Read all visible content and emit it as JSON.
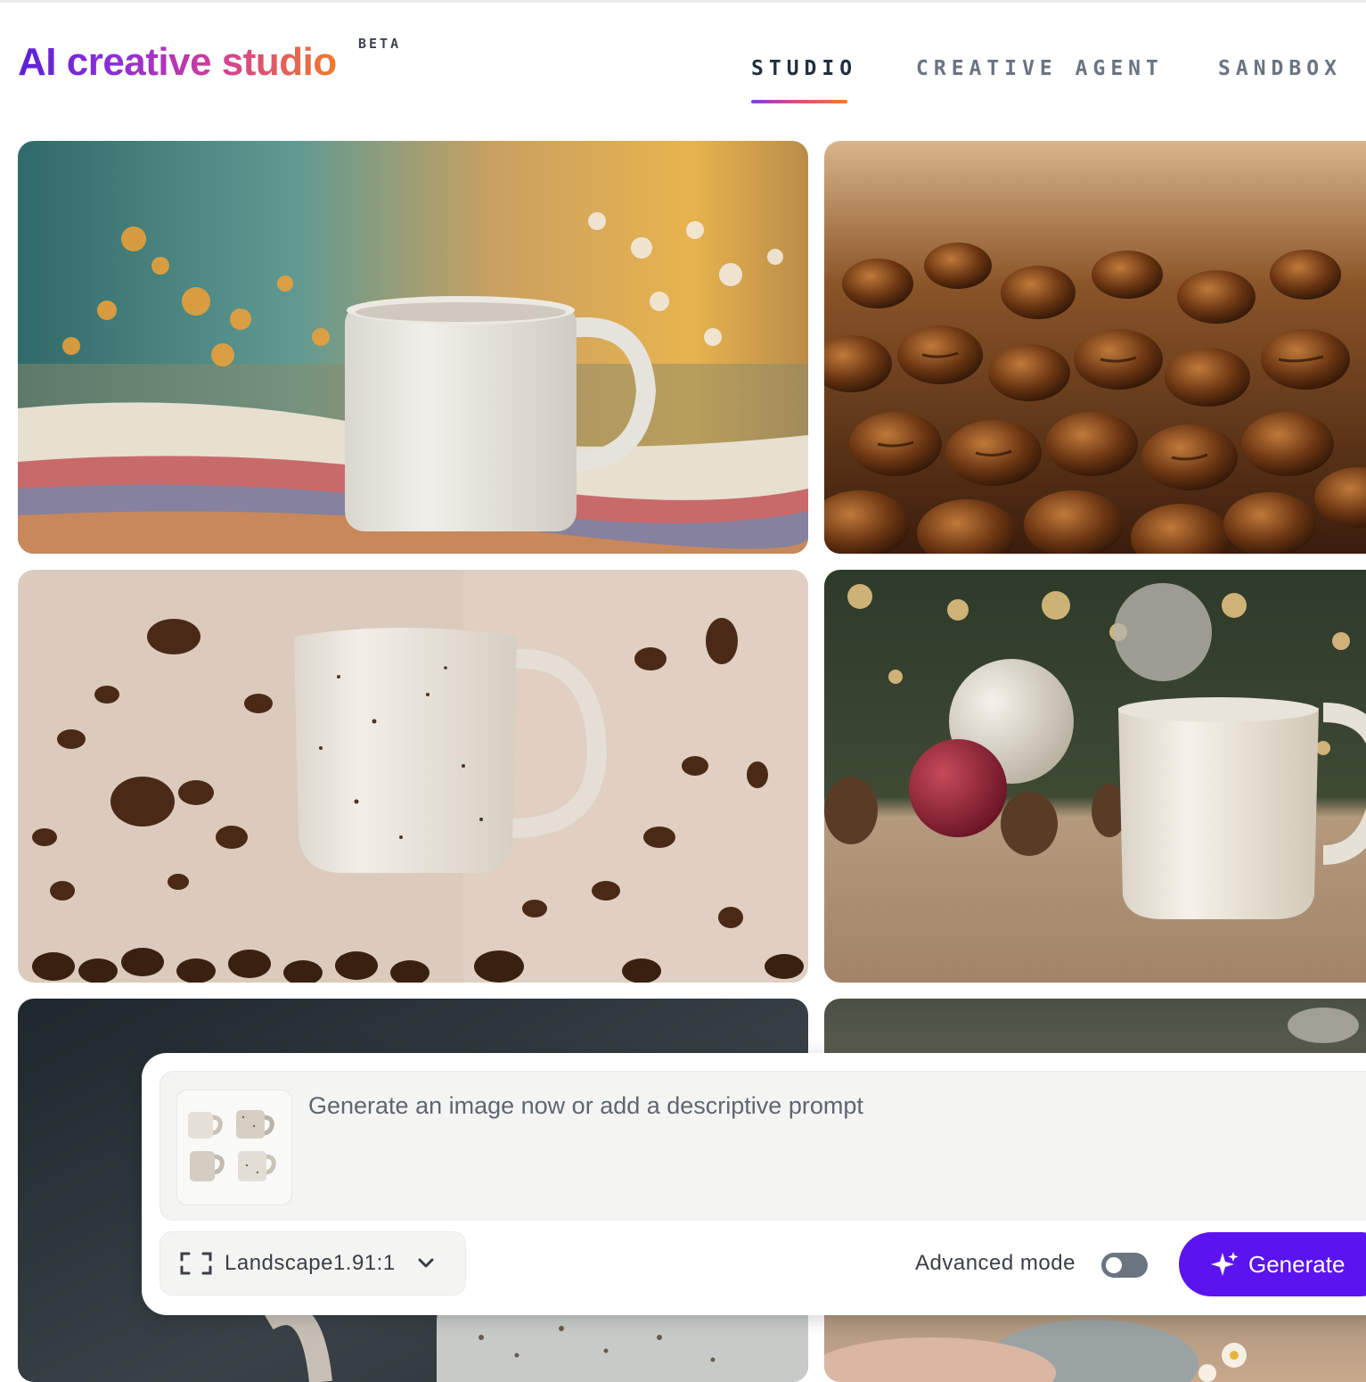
{
  "header": {
    "logo_text": "AI creative studio",
    "beta_badge": "BETA",
    "nav": [
      {
        "label": "STUDIO",
        "active": true
      },
      {
        "label": "CREATIVE AGENT",
        "active": false
      },
      {
        "label": "SANDBOX",
        "active": false
      }
    ]
  },
  "gallery": {
    "images": [
      {
        "subject": "speckled mug on woven blanket with wildflowers"
      },
      {
        "subject": "roasted coffee beans close-up"
      },
      {
        "subject": "speckled mug floating among coffee beans"
      },
      {
        "subject": "white mug with christmas ornaments and pinecones"
      },
      {
        "subject": "speckled mug on dark background"
      },
      {
        "subject": "mug with knitted textile and daisies"
      }
    ]
  },
  "prompt": {
    "placeholder": "Generate an image now or add a descriptive prompt",
    "value": "",
    "thumbnail_icon": "product-mugs-thumbnail"
  },
  "controls": {
    "aspect_ratio": "Landscape1.91:1",
    "aspect_icon": "frame-corners-icon",
    "advanced_mode_label": "Advanced mode",
    "advanced_mode_on": false,
    "generate_label": "Generate",
    "generate_icon": "sparkle-icon"
  },
  "colors": {
    "generate_button": "#5b13f0",
    "toggle_off": "#6b7580",
    "nav_active": "#232f3e",
    "nav_inactive": "#6b7380"
  }
}
